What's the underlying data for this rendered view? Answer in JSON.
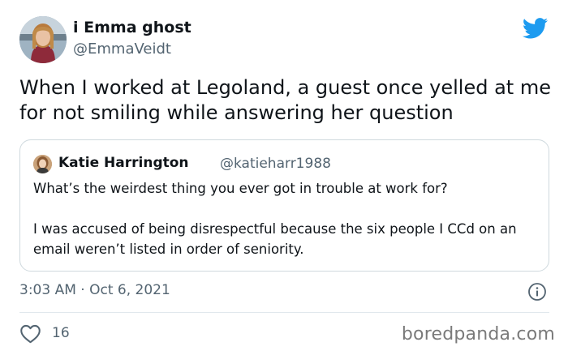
{
  "tweet": {
    "author": {
      "display_name": "i Emma ghost",
      "handle": "@EmmaVeidt"
    },
    "text": "When I worked at Legoland, a guest once yelled at me for not smiling while answering her question",
    "quoted": {
      "display_name": "Katie Harrington",
      "handle": "@katieharr1988",
      "paragraphs": [
        "What’s the weirdest thing you ever got in trouble at work for?",
        "I was accused of being disrespectful because the six people I CCd on an email weren’t listed in order of seniority."
      ]
    },
    "timestamp": "3:03 AM · Oct 6, 2021",
    "likes": "16"
  },
  "watermark": "boredpanda.com",
  "icons": {
    "brand": "twitter-bird-icon",
    "info": "info-icon",
    "like": "heart-icon"
  },
  "colors": {
    "twitter_blue": "#1d9bf0",
    "text_primary": "#0f1419",
    "text_secondary": "#536471",
    "border": "#cfd9de"
  }
}
